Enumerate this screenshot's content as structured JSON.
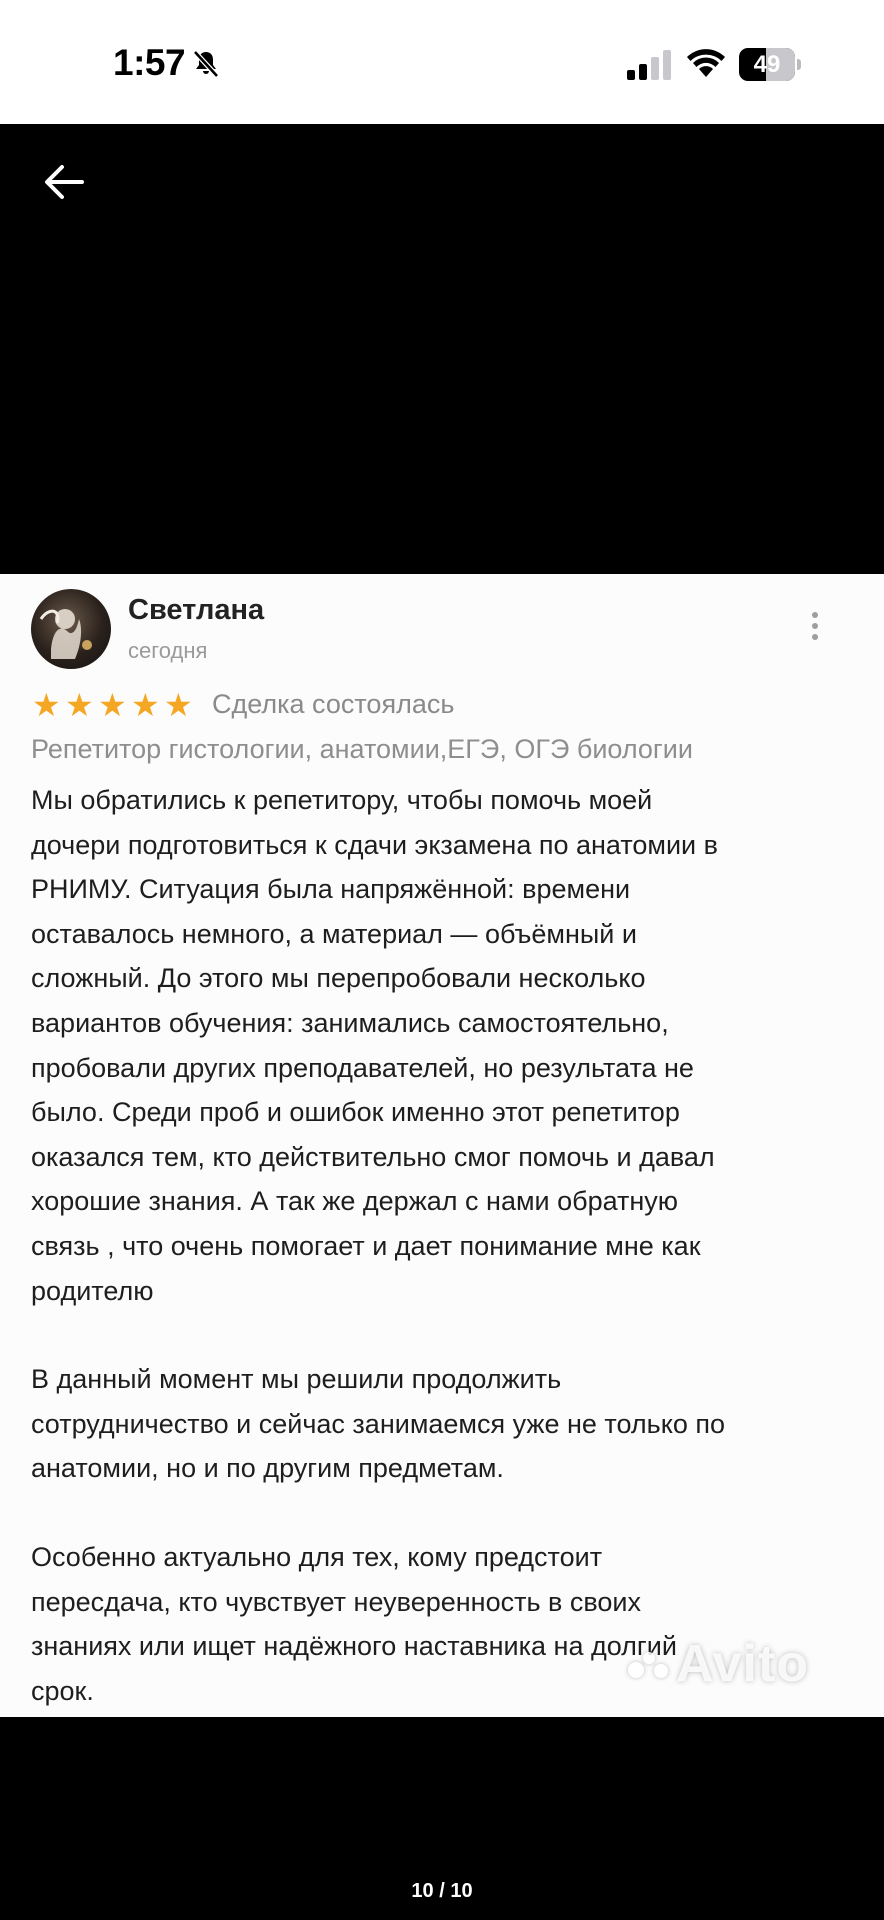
{
  "status_bar": {
    "time": "1:57",
    "battery_percent": "49",
    "battery_level": 0.49
  },
  "review": {
    "reviewer_name": "Светлана",
    "date": "сегодня",
    "rating": 5,
    "deal_status": "Сделка состоялась",
    "service": "Репетитор гистологии, анатомии,ЕГЭ, ОГЭ биологии",
    "paragraphs": [
      "Мы обратились к репетитору, чтобы помочь моей\nдочери подготовиться к сдачи экзамена по анатомии в\nРНИМУ. Ситуация была напряжённой: времени\nоставалось немного, а материал — объёмный и\nсложный. До этого мы перепробовали несколько\nвариантов обучения: занимались самостоятельно,\nпробовали других преподавателей, но результата не\nбыло. Среди проб и ошибок именно этот репетитор\nоказался тем, кто действительно смог помочь и давал\nхорошие знания. А так же держал с нами обратную\nсвязь , что очень помогает и дает понимание мне как\nродителю",
      "В данный момент мы решили продолжить\nсотрудничество и сейчас занимаемся уже не только по\nанатомии, но и по другим предметам.",
      "Особенно актуально для тех, кому предстоит\nпересдача, кто чувствует неуверенность в своих\nзнаниях или ищет надёжного наставника на долгий\nсрок."
    ],
    "watermark": "Avito"
  },
  "viewer": {
    "page_counter": "10 / 10"
  },
  "colors": {
    "star": "#f5a623",
    "background": "#000000"
  }
}
